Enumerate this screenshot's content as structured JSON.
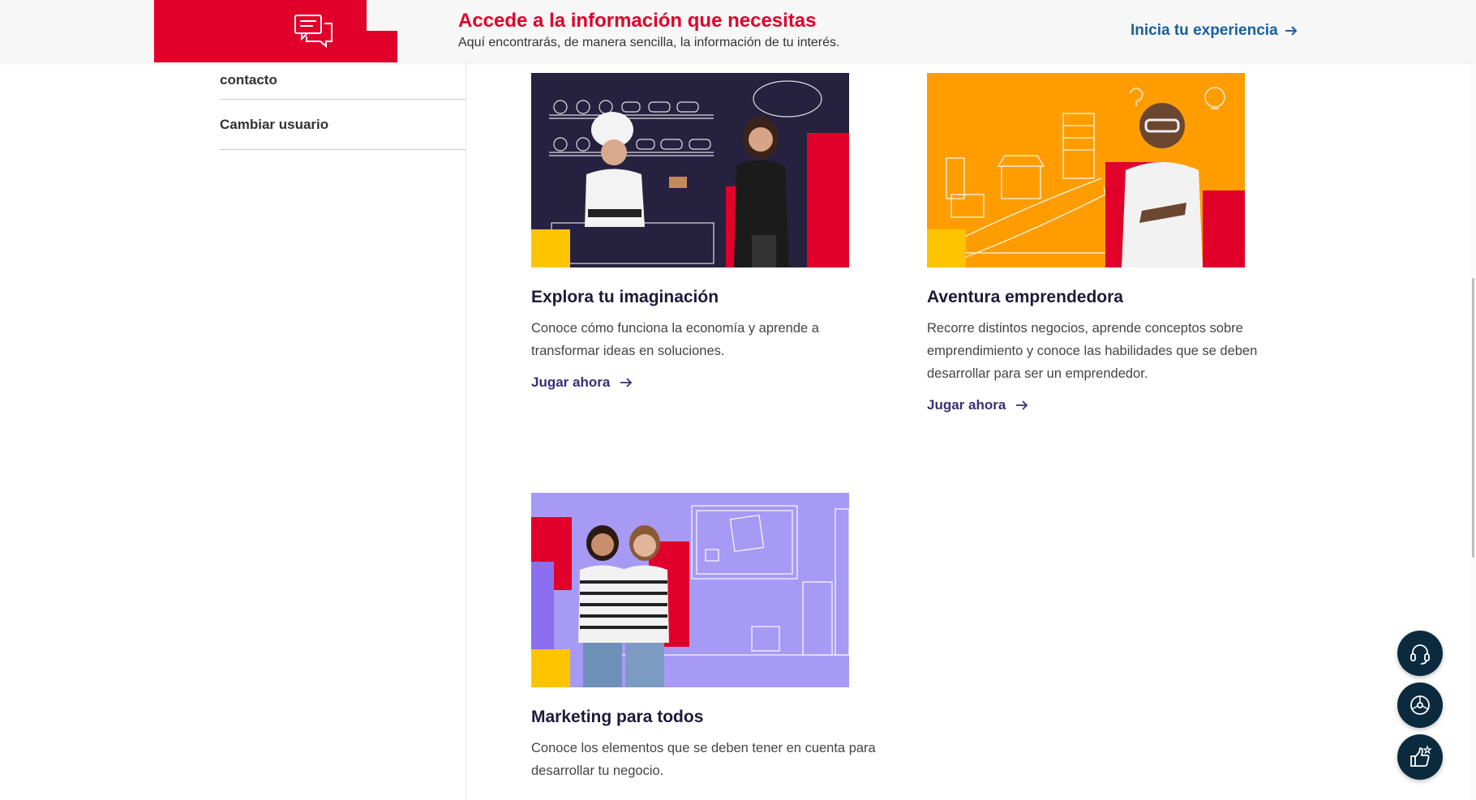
{
  "banner": {
    "title": "Accede a la información que necesitas",
    "subtitle": "Aquí encontrarás, de manera sencilla, la información de tu interés.",
    "cta_label": "Inicia tu experiencia",
    "icon": "chat-bubbles-icon",
    "accent_color": "#e0002a",
    "cta_color": "#1a5fa0"
  },
  "sidebar": {
    "items": [
      {
        "label": "contacto"
      },
      {
        "label": "Cambiar usuario"
      }
    ]
  },
  "cards": [
    {
      "title": "Explora tu imaginación",
      "description": "Conoce cómo funciona la economía y aprende a transformar ideas en soluciones.",
      "link": "Jugar ahora",
      "image_bg": "#26213f"
    },
    {
      "title": "Aventura emprendedora",
      "description": "Recorre distintos negocios, aprende conceptos sobre emprendimiento y conoce las habilidades que se deben desarrollar para ser un emprendedor.",
      "link": "Jugar ahora",
      "image_bg": "#ff9d00"
    },
    {
      "title": "Marketing para todos",
      "description": "Conoce los elementos que se deben tener en cuenta para desarrollar tu negocio.",
      "image_bg": "#a79af5"
    }
  ],
  "floating_buttons": [
    {
      "icon": "headset-icon"
    },
    {
      "icon": "wheel-icon"
    },
    {
      "icon": "thumbs-up-star-icon"
    }
  ]
}
